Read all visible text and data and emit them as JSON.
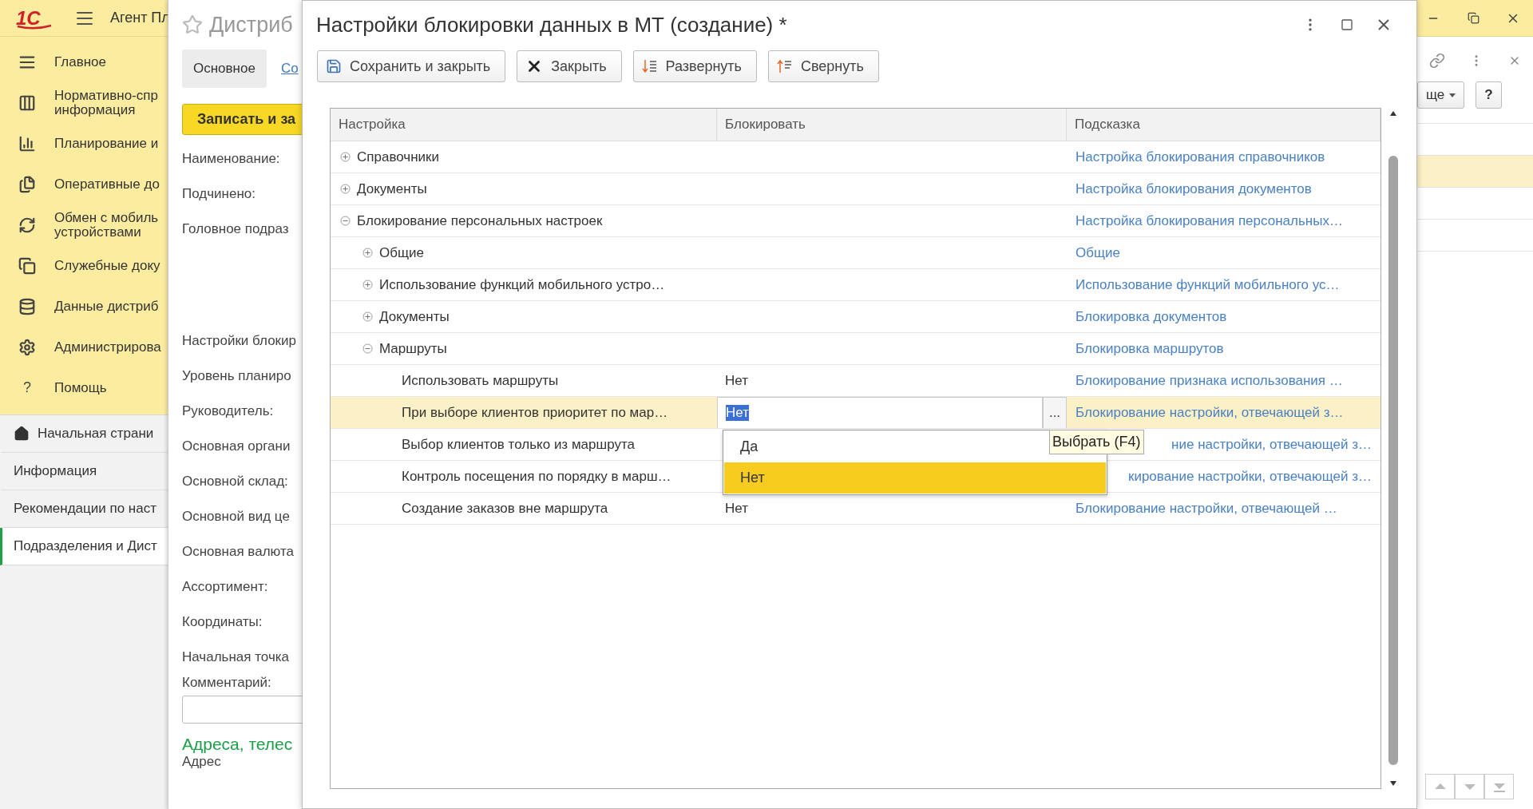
{
  "app": {
    "logo": "1С",
    "title": "Агент Пл"
  },
  "sidebar": {
    "items": [
      {
        "label": "Главное"
      },
      {
        "label": "Нормативно-спр\nинформация"
      },
      {
        "label": "Планирование и"
      },
      {
        "label": "Оперативные до"
      },
      {
        "label": "Обмен с мобиль\nустройствами"
      },
      {
        "label": "Служебные доку"
      },
      {
        "label": "Данные дистриб"
      },
      {
        "label": "Администрирова"
      },
      {
        "label": "Помощь",
        "glyph": "?"
      }
    ]
  },
  "nav": [
    {
      "label": "Начальная страни",
      "selected": false
    },
    {
      "label": "Информация",
      "selected": false
    },
    {
      "label": "Рекомендации по наст",
      "selected": false
    },
    {
      "label": "Подразделения и Дист",
      "selected": true
    }
  ],
  "back_form": {
    "title": "Дистриб",
    "tabs": [
      {
        "label": "Основное",
        "selected": true
      },
      {
        "label": "Со",
        "selected": false
      }
    ],
    "save_button": "Записать и за",
    "fields": [
      {
        "label": "Наименование:"
      },
      {
        "label": "Подчинено:"
      },
      {
        "label": "Головное подраз",
        "kind": "tall"
      },
      {
        "label": "Настройки блокир"
      },
      {
        "label": "Уровень планиро"
      },
      {
        "label": "Руководитель:"
      },
      {
        "label": "Основная органи"
      },
      {
        "label": "Основной склад:"
      },
      {
        "label": "Основной вид це"
      },
      {
        "label": "Основная валюта"
      },
      {
        "label": "Ассортимент:"
      },
      {
        "label": "Координаты:"
      },
      {
        "label": "Начальная точка"
      }
    ],
    "comment_label": "Комментарий:",
    "section_title": "Адреса, телес",
    "address_label": "Адрес"
  },
  "right_panel": {
    "more_button": "ще",
    "help_button": "?",
    "rows": [
      {
        "selected": false
      },
      {
        "selected": true
      },
      {
        "selected": false
      },
      {
        "selected": false
      }
    ]
  },
  "dialog": {
    "title": "Настройки блокировки данных в МТ (создание) *",
    "toolbar": [
      "Сохранить и закрыть",
      "Закрыть",
      "Развернуть",
      "Свернуть"
    ],
    "table": {
      "columns": [
        "Настройка",
        "Блокировать",
        "Подсказка"
      ],
      "rows": [
        {
          "name": "Справочники",
          "expanded": false,
          "selected": false,
          "hint": "Настройка блокирования справочников"
        },
        {
          "name": "Документы",
          "expanded": false,
          "selected": false,
          "hint": "Настройка блокирования документов"
        },
        {
          "name": "Блокирование персональных настроек",
          "expanded": true,
          "selected": false,
          "hint": "Настройка блокирования персональных…",
          "children": [
            {
              "name": "Общие",
              "expanded": false,
              "selected": false,
              "hint": "Общие"
            },
            {
              "name": "Использование функций мобильного устро…",
              "expanded": false,
              "selected": false,
              "hint": "Использование функций мобильного ус…"
            },
            {
              "name": "Документы",
              "expanded": false,
              "selected": false,
              "hint": "Блокировка документов"
            },
            {
              "name": "Маршруты",
              "expanded": true,
              "selected": false,
              "hint": "Блокировка маршрутов",
              "children": [
                {
                  "name": "Использовать маршруты",
                  "selected": false,
                  "value": "Нет",
                  "hint": "Блокирование признака использования …"
                },
                {
                  "name": "При выборе клиентов приоритет по мар…",
                  "selected": true,
                  "value": "Нет",
                  "hint": "Блокирование настройки, отвечающей з…"
                },
                {
                  "name": "Выбор клиентов только из маршрута",
                  "selected": false,
                  "hint": "ние настройки, отвечающей з…"
                },
                {
                  "name": "Контроль посещения по порядку в марш…",
                  "selected": false,
                  "hint": "кирование настройки, отвечающей з…"
                },
                {
                  "name": "Создание заказов вне маршрута",
                  "selected": false,
                  "value": "Нет",
                  "hint": "Блокирование настройки, отвечающей  …"
                }
              ]
            }
          ]
        }
      ],
      "edit_button": "...",
      "dropdown": [
        {
          "label": "Да",
          "selected": false
        },
        {
          "label": "Нет",
          "selected": true
        }
      ],
      "tooltip": "Выбрать (F4)"
    }
  }
}
